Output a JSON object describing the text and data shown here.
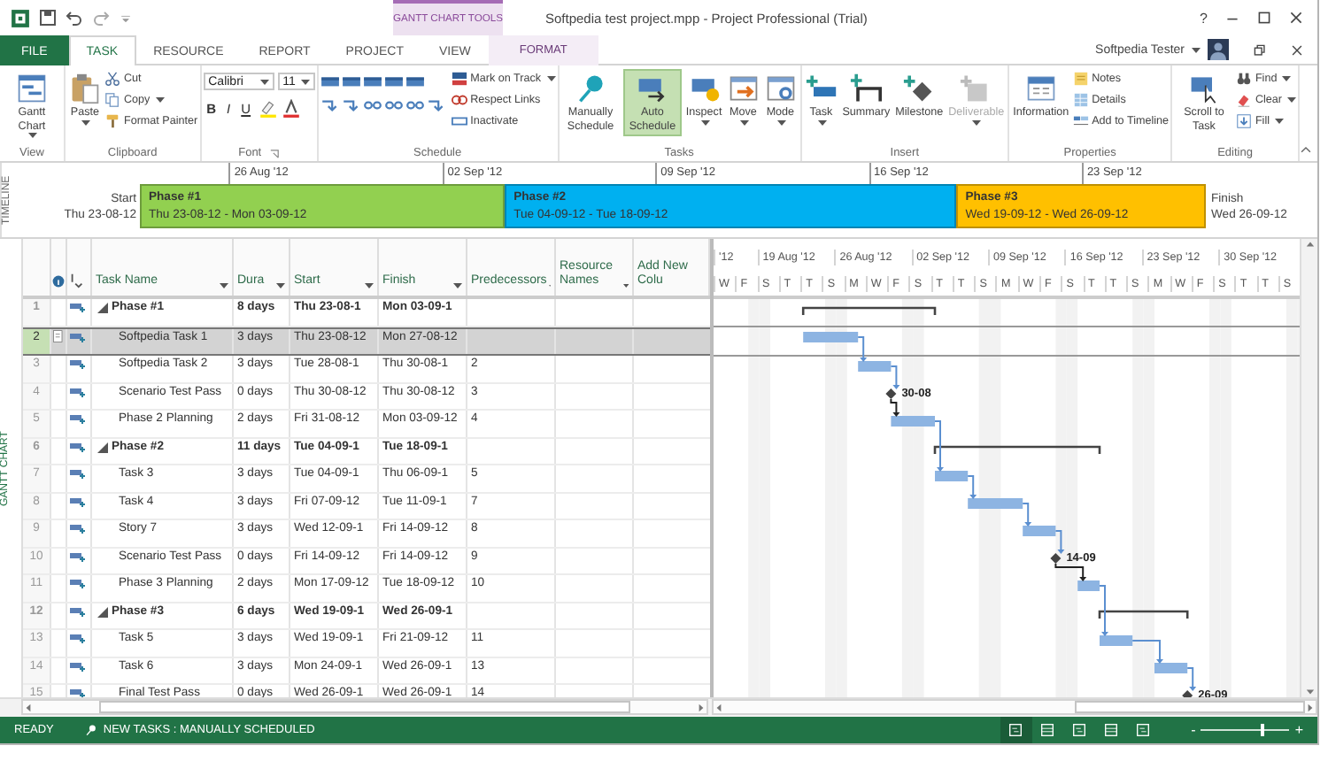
{
  "window": {
    "title": "Softpedia test project.mpp - Project Professional (Trial)",
    "context_title": "GANTT CHART TOOLS",
    "help": "?",
    "user": "Softpedia Tester"
  },
  "tabs": [
    {
      "label": "FILE",
      "kind": "file",
      "selected": false
    },
    {
      "label": "TASK",
      "kind": "normal",
      "selected": true
    },
    {
      "label": "RESOURCE",
      "kind": "normal",
      "selected": false
    },
    {
      "label": "REPORT",
      "kind": "normal",
      "selected": false
    },
    {
      "label": "PROJECT",
      "kind": "normal",
      "selected": false
    },
    {
      "label": "VIEW",
      "kind": "normal",
      "selected": false
    },
    {
      "label": "FORMAT",
      "kind": "contextual",
      "selected": false
    }
  ],
  "ribbon": {
    "groups": [
      {
        "label": "View",
        "kind": "standard",
        "items": [
          {
            "kind": "large",
            "label": "Gantt Chart",
            "dropdown": true
          }
        ]
      },
      {
        "label": "Clipboard",
        "kind": "standard",
        "items": [
          {
            "kind": "large",
            "label": "Paste",
            "dropdown": true
          },
          {
            "kind": "stack",
            "items": [
              {
                "label": "Cut",
                "dropdown": false
              },
              {
                "label": "Copy",
                "dropdown": true
              },
              {
                "label": "Format Painter",
                "dropdown": false
              }
            ]
          }
        ]
      },
      {
        "label": "Font",
        "kind": "font",
        "font_name": "Calibri",
        "font_size": "11",
        "format_buttons": [
          {
            "label": "B",
            "kind": "bold"
          },
          {
            "label": "I",
            "kind": "italic"
          },
          {
            "label": "U",
            "kind": "underline"
          }
        ]
      },
      {
        "label": "Schedule",
        "kind": "schedule",
        "items": [
          {
            "kind": "stack",
            "items": [
              {
                "label": "Mark on Track",
                "dropdown": true
              },
              {
                "label": "Respect Links",
                "dropdown": false
              },
              {
                "label": "Inactivate",
                "dropdown": false
              }
            ]
          }
        ]
      },
      {
        "label": "Tasks",
        "kind": "standard",
        "items": [
          {
            "kind": "large",
            "label": "Manually Schedule",
            "dropdown": false,
            "selected": false
          },
          {
            "kind": "large",
            "label": "Auto Schedule",
            "dropdown": false,
            "selected": true
          },
          {
            "kind": "large",
            "label": "Inspect",
            "dropdown": true,
            "selected": false
          },
          {
            "kind": "large",
            "label": "Move",
            "dropdown": true,
            "selected": false
          },
          {
            "kind": "large",
            "label": "Mode",
            "dropdown": true,
            "selected": false
          }
        ]
      },
      {
        "label": "Insert",
        "kind": "standard",
        "items": [
          {
            "kind": "large",
            "label": "Task",
            "dropdown": true,
            "disabled": false
          },
          {
            "kind": "large",
            "label": "Summary",
            "dropdown": false,
            "disabled": false
          },
          {
            "kind": "large",
            "label": "Milestone",
            "dropdown": false,
            "disabled": false
          },
          {
            "kind": "large",
            "label": "Deliverable",
            "dropdown": true,
            "disabled": true
          }
        ]
      },
      {
        "label": "Properties",
        "kind": "standard",
        "items": [
          {
            "kind": "large",
            "label": "Information",
            "dropdown": false
          },
          {
            "kind": "stack",
            "items": [
              {
                "label": "Notes",
                "dropdown": false
              },
              {
                "label": "Details",
                "dropdown": false
              },
              {
                "label": "Add to Timeline",
                "dropdown": false
              }
            ]
          }
        ]
      },
      {
        "label": "Editing",
        "kind": "standard",
        "items": [
          {
            "kind": "large",
            "label": "Scroll to Task",
            "dropdown": false
          },
          {
            "kind": "stack",
            "items": [
              {
                "label": "Find",
                "dropdown": true
              },
              {
                "label": "Clear",
                "dropdown": true
              },
              {
                "label": "Fill",
                "dropdown": true
              }
            ]
          }
        ]
      }
    ]
  },
  "timeline": {
    "label": "TIMELINE",
    "start_label": "Start",
    "start_date": "Thu 23-08-12",
    "ticks": [
      "26 Aug '12",
      "02 Sep '12",
      "09 Sep '12",
      "16 Sep '12",
      "23 Sep '12"
    ],
    "phases": [
      {
        "name": "Phase #1",
        "dates": "Thu 23-08-12 - Mon 03-09-12",
        "color": "#92d050"
      },
      {
        "name": "Phase #2",
        "dates": "Tue 04-09-12 - Tue 18-09-12",
        "color": "#00b0f0"
      },
      {
        "name": "Phase #3",
        "dates": "Wed 19-09-12 - Wed 26-09-12",
        "color": "#ffc000"
      }
    ],
    "finish_label": "Finish",
    "finish_date": "Wed 26-09-12"
  },
  "table": {
    "side_label": "GANTT CHART",
    "columns": [
      "Task Name",
      "Dura",
      "Start",
      "Finish",
      "Predecessors",
      "Resource Names",
      "Add New Colu"
    ],
    "rows": [
      {
        "id": "1",
        "kind": "summary",
        "name": "Phase #1",
        "expanded": true,
        "duration": "8 days",
        "start": "Thu 23-08-1",
        "finish": "Mon 03-09-1",
        "selected": false,
        "indicator": false,
        "children": [
          {
            "id": "2",
            "kind": "task",
            "name": "Softpedia Task 1",
            "duration": "3 days",
            "start": "Thu 23-08-12",
            "finish": "Mon 27-08-12",
            "selected": true,
            "indicator": true
          },
          {
            "id": "3",
            "kind": "task",
            "name": "Softpedia Task 2",
            "duration": "3 days",
            "start": "Tue 28-08-1",
            "finish": "Thu 30-08-1",
            "predecessors": "2",
            "selected": false,
            "indicator": false
          },
          {
            "id": "4",
            "kind": "milestone",
            "name": "Scenario Test Pass",
            "duration": "0 days",
            "start": "Thu 30-08-12",
            "finish": "Thu 30-08-12",
            "predecessors": "3",
            "gantt_label": "30-08",
            "selected": false,
            "indicator": false
          },
          {
            "id": "5",
            "kind": "task",
            "name": "Phase 2 Planning",
            "duration": "2 days",
            "start": "Fri 31-08-12",
            "finish": "Mon 03-09-12",
            "predecessors": "4",
            "selected": false,
            "indicator": false
          }
        ]
      },
      {
        "id": "6",
        "kind": "summary",
        "name": "Phase #2",
        "expanded": true,
        "duration": "11 days",
        "start": "Tue 04-09-1",
        "finish": "Tue 18-09-1",
        "selected": false,
        "indicator": false,
        "children": [
          {
            "id": "7",
            "kind": "task",
            "name": "Task 3",
            "duration": "3 days",
            "start": "Tue 04-09-1",
            "finish": "Thu 06-09-1",
            "predecessors": "5",
            "selected": false,
            "indicator": false
          },
          {
            "id": "8",
            "kind": "task",
            "name": "Task 4",
            "duration": "3 days",
            "start": "Fri 07-09-12",
            "finish": "Tue 11-09-1",
            "predecessors": "7",
            "selected": false,
            "indicator": false
          },
          {
            "id": "9",
            "kind": "task",
            "name": "Story 7",
            "duration": "3 days",
            "start": "Wed 12-09-1",
            "finish": "Fri 14-09-12",
            "predecessors": "8",
            "selected": false,
            "indicator": false
          },
          {
            "id": "10",
            "kind": "milestone",
            "name": "Scenario Test Pass",
            "duration": "0 days",
            "start": "Fri 14-09-12",
            "finish": "Fri 14-09-12",
            "predecessors": "9",
            "gantt_label": "14-09",
            "selected": false,
            "indicator": false
          },
          {
            "id": "11",
            "kind": "task",
            "name": "Phase 3 Planning",
            "duration": "2 days",
            "start": "Mon 17-09-12",
            "finish": "Tue 18-09-12",
            "predecessors": "10",
            "selected": false,
            "indicator": false
          }
        ]
      },
      {
        "id": "12",
        "kind": "summary",
        "name": "Phase #3",
        "expanded": true,
        "duration": "6 days",
        "start": "Wed 19-09-1",
        "finish": "Wed 26-09-1",
        "selected": false,
        "indicator": false,
        "children": [
          {
            "id": "13",
            "kind": "task",
            "name": "Task 5",
            "duration": "3 days",
            "start": "Wed 19-09-1",
            "finish": "Fri 21-09-12",
            "predecessors": "11",
            "selected": false,
            "indicator": false
          },
          {
            "id": "14",
            "kind": "task",
            "name": "Task 6",
            "duration": "3 days",
            "start": "Mon 24-09-1",
            "finish": "Wed 26-09-1",
            "predecessors": "13",
            "selected": false,
            "indicator": false
          },
          {
            "id": "15",
            "kind": "milestone",
            "name": "Final Test Pass",
            "duration": "0 days",
            "start": "Wed 26-09-1",
            "finish": "Wed 26-09-1",
            "predecessors": "14",
            "gantt_label": "26-09",
            "selected": false,
            "indicator": false
          }
        ]
      }
    ]
  },
  "gantt": {
    "week_labels": [
      "'12",
      "19 Aug '12",
      "26 Aug '12",
      "02 Sep '12",
      "09 Sep '12",
      "16 Sep '12",
      "23 Sep '12",
      "30 Sep '12"
    ],
    "day_labels": [
      "W",
      "F",
      "S",
      "T",
      "T",
      "S",
      "M",
      "W",
      "F",
      "S",
      "T",
      "T",
      "S",
      "M",
      "W",
      "F",
      "S",
      "T",
      "T",
      "S",
      "M",
      "W",
      "F",
      "S",
      "T",
      "T",
      "S"
    ]
  },
  "status_bar": {
    "ready": "READY",
    "new_tasks": "NEW TASKS : MANUALLY SCHEDULED",
    "zoom_minus": "-",
    "zoom_plus": "+",
    "zoom": {
      "level": 0.68
    }
  }
}
